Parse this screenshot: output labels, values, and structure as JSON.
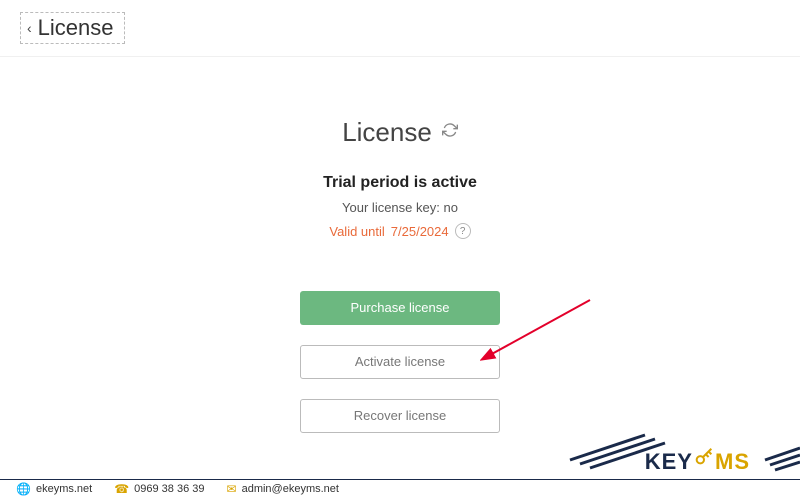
{
  "header": {
    "back_label": "License"
  },
  "main": {
    "title": "License",
    "status": "Trial period is active",
    "key_label_prefix": "Your license key: ",
    "key_value": "no",
    "valid_prefix": "Valid until ",
    "valid_date": "7/25/2024",
    "help_glyph": "?"
  },
  "buttons": {
    "purchase": "Purchase license",
    "activate": "Activate license",
    "recover": "Recover license"
  },
  "footer": {
    "brand_key": "KEY",
    "brand_ms": "MS",
    "website": "ekeyms.net",
    "phone": "0969 38 36 39",
    "email": "admin@ekeyms.net"
  },
  "colors": {
    "accent_green": "#6cb880",
    "warn_orange": "#e96a3a",
    "brand_gold": "#d9a400",
    "brand_navy": "#1a2a4a"
  }
}
